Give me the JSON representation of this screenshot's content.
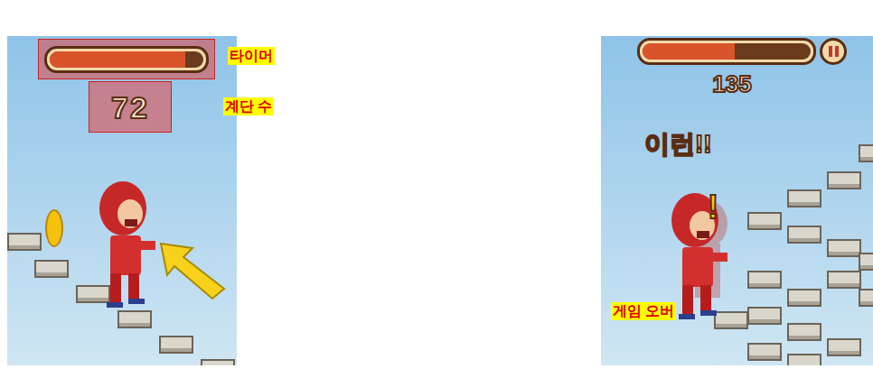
{
  "left_screen": {
    "timer": {
      "level": 0.88,
      "label": "타이머"
    },
    "steps": {
      "value": "72",
      "label": "계단 수"
    }
  },
  "right_screen": {
    "timer": {
      "level": 0.55
    },
    "steps": {
      "value": "135"
    },
    "exclaim": "이런!!",
    "state_label": "게임 오버"
  }
}
